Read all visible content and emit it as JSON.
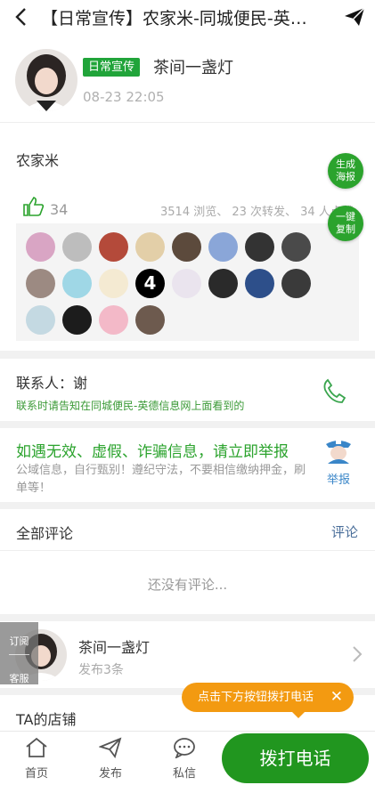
{
  "header": {
    "title": "【日常宣传】农家米-同城便民-英…",
    "back_icon": "chevron-left-icon",
    "share_icon": "paper-plane-icon"
  },
  "author": {
    "tag": "日常宣传",
    "name": "茶间一盏灯",
    "time": "08-23 22:05"
  },
  "post": {
    "content": "农家米",
    "likes": "34",
    "stats": "3514 浏览、 23 次转发、 34 人点赞"
  },
  "fabs": {
    "poster": "生成海报",
    "copy": "一键复制"
  },
  "contact": {
    "person": "联系人：谢",
    "hint": "联系时请告知在同城便民-英德信息网上面看到的"
  },
  "warning": {
    "headline": "如遇无效、虚假、诈骗信息，请立即举报",
    "body": "公域信息，自行甄别！遵纪守法，不要相信缴纳押金，刷单等！",
    "report_label": "举报"
  },
  "comments": {
    "heading": "全部评论",
    "link": "评论",
    "empty": "还没有评论..."
  },
  "profile": {
    "name": "茶间一盏灯",
    "count": "发布3条"
  },
  "side_tab": {
    "top": "订阅",
    "bottom": "客服"
  },
  "shop": {
    "heading": "TA的店铺"
  },
  "tooltip": {
    "text": "点击下方按钮拨打电话"
  },
  "bottom_nav": {
    "items": [
      {
        "label": "首页",
        "icon": "home-icon"
      },
      {
        "label": "发布",
        "icon": "send-icon"
      },
      {
        "label": "私信",
        "icon": "chat-icon"
      }
    ],
    "call_button": "拨打电话"
  },
  "colors": {
    "brand_green": "#21a43a",
    "call_green": "#21961f",
    "tooltip_orange": "#f39a11",
    "link_blue": "#3a86c8"
  }
}
